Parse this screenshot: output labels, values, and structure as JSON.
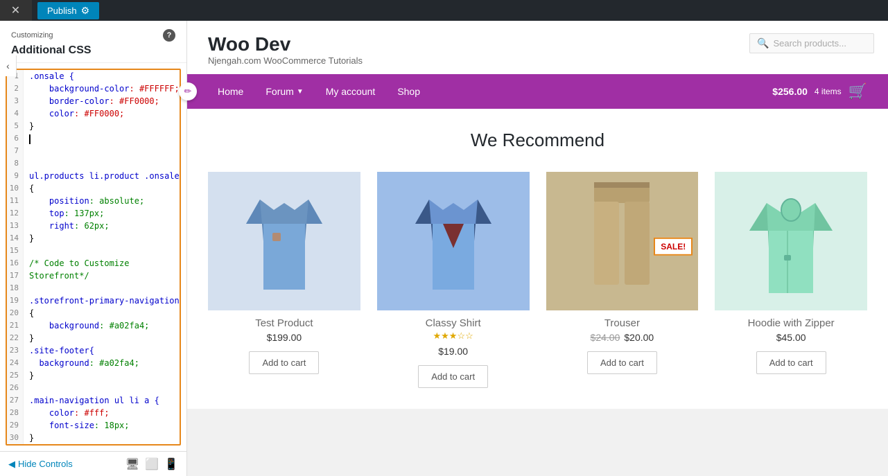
{
  "topbar": {
    "close_icon": "✕",
    "publish_label": "Publish",
    "gear_icon": "⚙"
  },
  "sidebar": {
    "customizing_label": "Customizing",
    "section_title": "Additional CSS",
    "info_label": "?",
    "back_label": "‹",
    "code_lines": [
      {
        "num": 1,
        "content": ".onsale {",
        "type": "selector"
      },
      {
        "num": 2,
        "content": "    background-color: #FFFFFF;",
        "type": "property"
      },
      {
        "num": 3,
        "content": "    border-color: #FF0000;",
        "type": "property"
      },
      {
        "num": 4,
        "content": "    color: #FF0000;",
        "type": "property"
      },
      {
        "num": 5,
        "content": "}",
        "type": "brace"
      },
      {
        "num": 6,
        "content": "",
        "type": "cursor"
      },
      {
        "num": 7,
        "content": "",
        "type": "blank"
      },
      {
        "num": 8,
        "content": "",
        "type": "blank"
      },
      {
        "num": 9,
        "content": "ul.products li.product .onsale",
        "type": "selector"
      },
      {
        "num": 10,
        "content": "{",
        "type": "brace"
      },
      {
        "num": 11,
        "content": "    position: absolute;",
        "type": "property"
      },
      {
        "num": 12,
        "content": "    top: 137px;",
        "type": "property"
      },
      {
        "num": 13,
        "content": "    right: 62px;",
        "type": "property"
      },
      {
        "num": 14,
        "content": "}",
        "type": "brace"
      },
      {
        "num": 15,
        "content": "",
        "type": "blank"
      },
      {
        "num": 16,
        "content": "/* Code to Customize",
        "type": "comment"
      },
      {
        "num": 17,
        "content": "Storefront*/",
        "type": "comment"
      },
      {
        "num": 18,
        "content": "",
        "type": "blank"
      },
      {
        "num": 19,
        "content": ".storefront-primary-navigation",
        "type": "selector"
      },
      {
        "num": 20,
        "content": "{",
        "type": "brace"
      },
      {
        "num": 21,
        "content": "    background: #a02fa4;",
        "type": "property"
      },
      {
        "num": 22,
        "content": "}",
        "type": "brace"
      },
      {
        "num": 23,
        "content": ".site-footer{",
        "type": "selector"
      },
      {
        "num": 24,
        "content": "  background: #a02fa4;",
        "type": "property"
      },
      {
        "num": 25,
        "content": "}",
        "type": "brace"
      },
      {
        "num": 26,
        "content": "",
        "type": "blank"
      },
      {
        "num": 27,
        "content": ".main-navigation ul li a {",
        "type": "selector"
      },
      {
        "num": 28,
        "content": "    color: #fff;",
        "type": "property"
      },
      {
        "num": 29,
        "content": "    font-size: 18px;",
        "type": "property"
      },
      {
        "num": 30,
        "content": "}",
        "type": "brace"
      }
    ],
    "bottom": {
      "hide_controls_label": "Hide Controls",
      "hide_icon": "◀",
      "device_desktop": "🖥",
      "device_tablet": "⬜",
      "device_mobile": "📱"
    }
  },
  "preview": {
    "site_title": "Woo Dev",
    "site_tagline": "Njengah.com WooCommerce Tutorials",
    "search_placeholder": "Search products...",
    "nav": {
      "items": [
        {
          "label": "Home",
          "has_dropdown": false
        },
        {
          "label": "Forum",
          "has_dropdown": true
        },
        {
          "label": "My account",
          "has_dropdown": false
        },
        {
          "label": "Shop",
          "has_dropdown": false
        }
      ],
      "cart_amount": "$256.00",
      "cart_count": "4 items",
      "cart_icon": "🛒"
    },
    "section_title": "We Recommend",
    "products": [
      {
        "name": "Test Product",
        "price": "$199.00",
        "original_price": null,
        "sale_price": null,
        "rating": 0,
        "on_sale": false,
        "add_to_cart_label": "Add to cart",
        "img_color": "#d4e0ef"
      },
      {
        "name": "Classy Shirt",
        "price": "$19.00",
        "original_price": null,
        "sale_price": null,
        "rating": 3,
        "on_sale": false,
        "add_to_cart_label": "Add to cart",
        "img_color": "#9dbde8"
      },
      {
        "name": "Trouser",
        "price": "$20.00",
        "original_price": "$24.00",
        "sale_price": "$20.00",
        "rating": 0,
        "on_sale": true,
        "sale_label": "SALE!",
        "add_to_cart_label": "Add to cart",
        "img_color": "#c8b890"
      },
      {
        "name": "Hoodie with Zipper",
        "price": "$45.00",
        "original_price": null,
        "sale_price": null,
        "rating": 0,
        "on_sale": false,
        "add_to_cart_label": "Add to cart",
        "img_color": "#d8f0e8"
      }
    ]
  }
}
